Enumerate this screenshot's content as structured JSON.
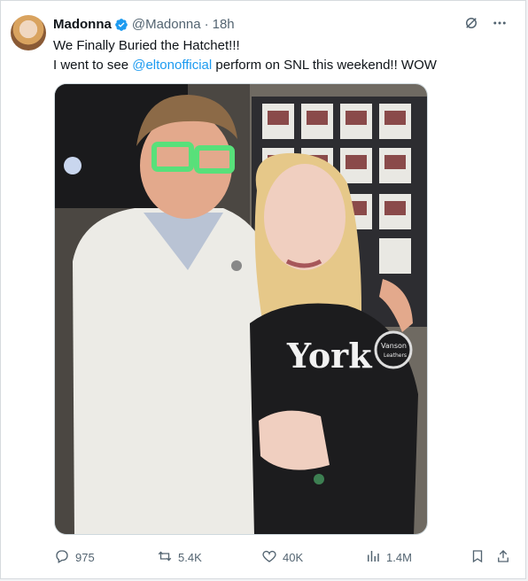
{
  "tweet": {
    "author_name": "Madonna",
    "handle": "@Madonna",
    "separator": "·",
    "time": "18h",
    "line1": "We Finally Buried the Hatchet!!!",
    "line2_before": "I went to see ",
    "mention": "@eltonofficial",
    "line2_after": " perform on SNL this weekend!! WOW",
    "jacket_text": "York",
    "patch_text": "Vanson",
    "patch_sub": "Leathers"
  },
  "stats": {
    "replies": "975",
    "reposts": "5.4K",
    "likes": "40K",
    "views": "1.4M"
  },
  "colors": {
    "accent": "#1d9bf0",
    "muted": "#536471",
    "verified": "#1d9bf0"
  },
  "icons": [
    "verified-badge-icon",
    "grok-icon",
    "more-icon",
    "reply-icon",
    "repost-icon",
    "like-icon",
    "views-icon",
    "bookmark-icon",
    "share-icon"
  ]
}
